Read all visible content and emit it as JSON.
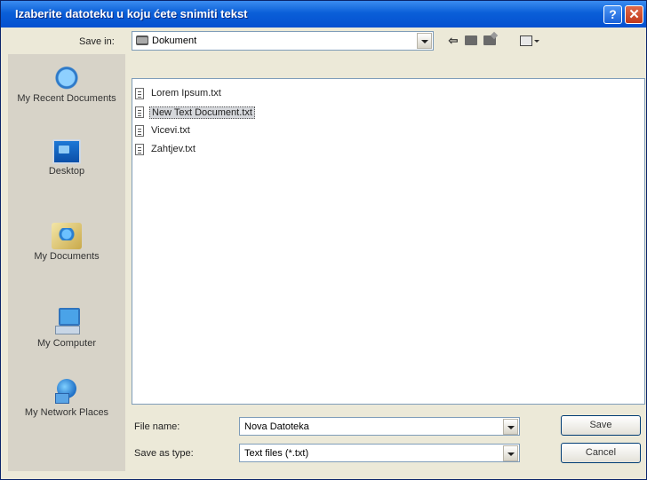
{
  "titlebar": {
    "title": "Izaberite datoteku u koju ćete snimiti tekst",
    "help_glyph": "?",
    "close_glyph": "✕"
  },
  "toolbar": {
    "save_in_label": "Save in:",
    "save_in_value": "Dokument",
    "back_icon": "back-arrow-icon",
    "up_icon": "up-folder-icon",
    "new_folder_icon": "new-folder-icon",
    "views_icon": "views-menu-icon"
  },
  "places": [
    {
      "label": "My Recent Documents",
      "icon": "recent-documents-icon"
    },
    {
      "label": "Desktop",
      "icon": "desktop-icon"
    },
    {
      "label": "My Documents",
      "icon": "my-documents-icon"
    },
    {
      "label": "My Computer",
      "icon": "my-computer-icon"
    },
    {
      "label": "My Network Places",
      "icon": "network-places-icon"
    }
  ],
  "files": [
    {
      "name": "Lorem Ipsum.txt",
      "selected": false
    },
    {
      "name": "New Text Document.txt",
      "selected": true
    },
    {
      "name": "Vicevi.txt",
      "selected": false
    },
    {
      "name": "Zahtjev.txt",
      "selected": false
    }
  ],
  "form": {
    "file_name_label": "File name:",
    "file_name_value": "Nova Datoteka",
    "save_as_type_label": "Save as type:",
    "save_as_type_value": "Text files (*.txt)"
  },
  "buttons": {
    "save": "Save",
    "cancel": "Cancel"
  }
}
